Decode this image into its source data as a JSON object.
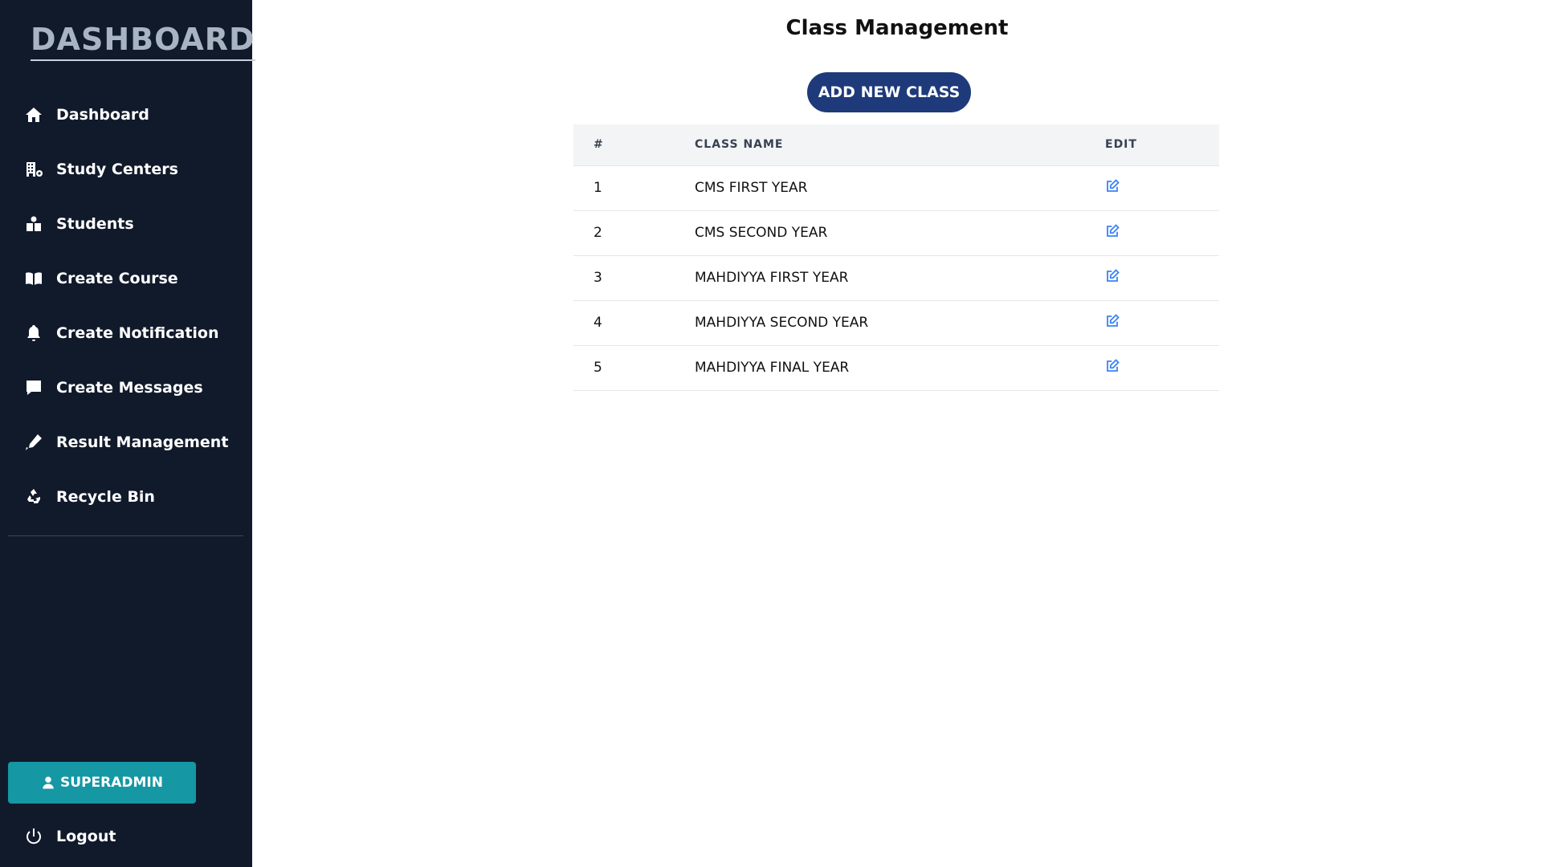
{
  "sidebar": {
    "brand": "DASHBOARD",
    "items": [
      {
        "label": "Dashboard",
        "icon": "home-icon"
      },
      {
        "label": "Study Centers",
        "icon": "building-icon"
      },
      {
        "label": "Students",
        "icon": "students-icon"
      },
      {
        "label": "Create Course",
        "icon": "book-icon"
      },
      {
        "label": "Create Notification",
        "icon": "bell-icon"
      },
      {
        "label": "Create Messages",
        "icon": "message-icon"
      },
      {
        "label": "Result Management",
        "icon": "pen-icon"
      },
      {
        "label": "Recycle Bin",
        "icon": "recycle-icon"
      }
    ],
    "user_button": "SUPERADMIN",
    "logout": "Logout"
  },
  "main": {
    "title": "Class Management",
    "add_button": "ADD NEW CLASS",
    "table": {
      "headers": [
        "#",
        "CLASS NAME",
        "EDIT"
      ],
      "rows": [
        {
          "num": "1",
          "name": "CMS FIRST YEAR"
        },
        {
          "num": "2",
          "name": "CMS SECOND YEAR"
        },
        {
          "num": "3",
          "name": "MAHDIYYA FIRST YEAR"
        },
        {
          "num": "4",
          "name": "MAHDIYYA SECOND YEAR"
        },
        {
          "num": "5",
          "name": "MAHDIYYA FINAL YEAR"
        }
      ]
    }
  },
  "colors": {
    "sidebar_bg": "#111a2b",
    "accent_button": "#1e3a7b",
    "user_button": "#1597a4",
    "edit_icon": "#3b82f6"
  }
}
